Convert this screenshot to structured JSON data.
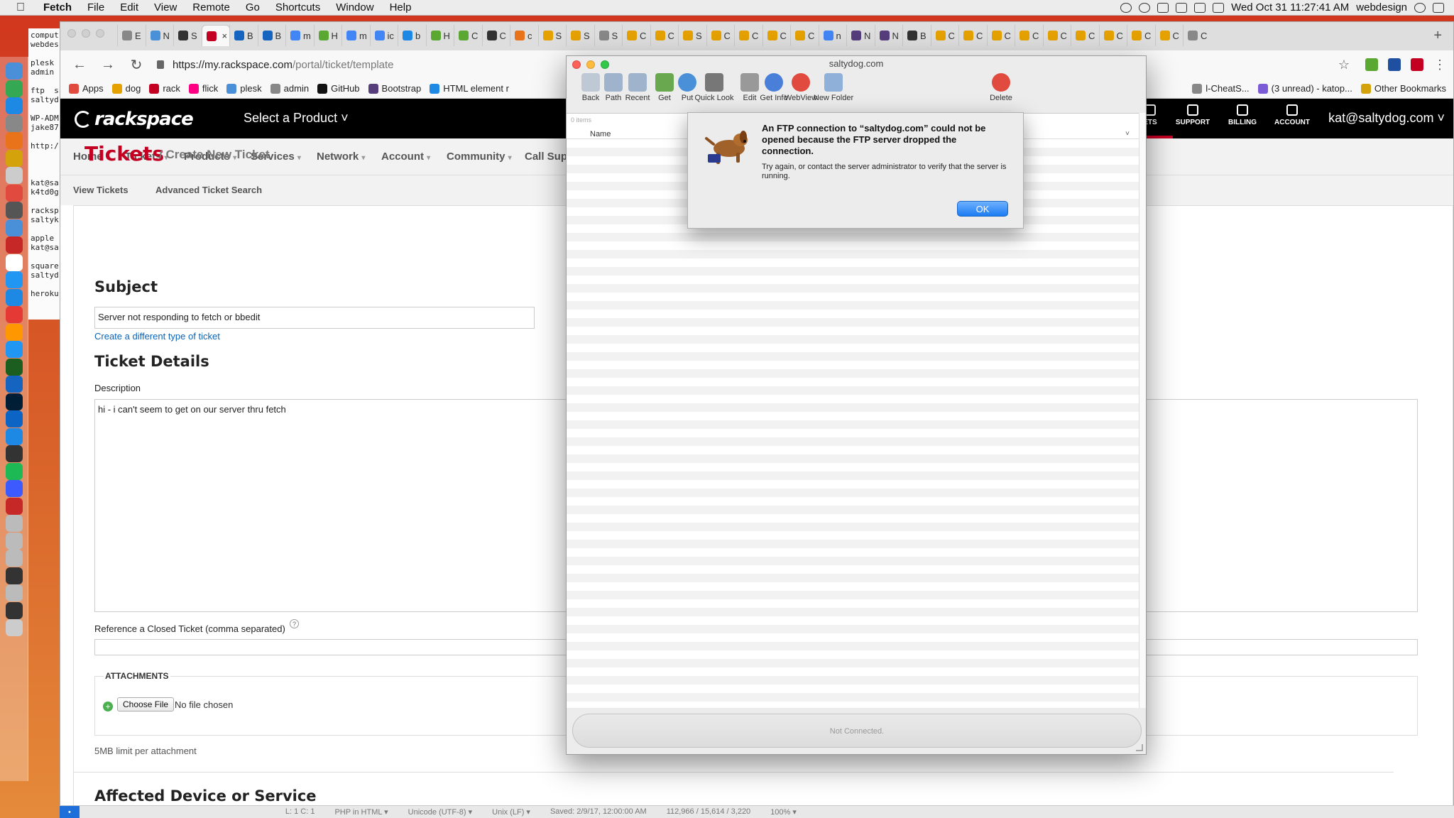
{
  "menubar": {
    "app_name": "Fetch",
    "items": [
      "File",
      "Edit",
      "View",
      "Remote",
      "Go",
      "Shortcuts",
      "Window",
      "Help"
    ],
    "clock": "Wed Oct 31  11:27:41 AM",
    "user": "webdesign"
  },
  "stickies": {
    "lines": [
      "comput",
      "webdes",
      "",
      "plesk",
      "admin",
      "",
      "ftp  s",
      "saltyd",
      "",
      "WP-ADM",
      "jake87",
      "",
      "http:/",
      "",
      "",
      "",
      "kat@sa",
      "k4td0g",
      "",
      "racksp",
      "saltyk",
      "",
      "apple",
      "kat@sa",
      "",
      "square",
      "saltyd",
      "",
      "heroku"
    ]
  },
  "browser": {
    "tabs": [
      {
        "label": "E",
        "color": "#888888"
      },
      {
        "label": "N",
        "color": "#4a90d9"
      },
      {
        "label": "S",
        "color": "#333333"
      },
      {
        "label": "",
        "color": "#c40022"
      },
      {
        "label": "B",
        "color": "#1565c0"
      },
      {
        "label": "B",
        "color": "#1565c0"
      },
      {
        "label": "m",
        "color": "#4285f4"
      },
      {
        "label": "H",
        "color": "#5aa832"
      },
      {
        "label": "m",
        "color": "#4285f4"
      },
      {
        "label": "ic",
        "color": "#4285f4"
      },
      {
        "label": "b",
        "color": "#1e88e5"
      },
      {
        "label": "H",
        "color": "#5aa832"
      },
      {
        "label": "C",
        "color": "#5aa832"
      },
      {
        "label": "C",
        "color": "#333333"
      },
      {
        "label": "c",
        "color": "#e8731a"
      },
      {
        "label": "S",
        "color": "#e5a100"
      },
      {
        "label": "S",
        "color": "#e5a100"
      },
      {
        "label": "S",
        "color": "#888888"
      },
      {
        "label": "C",
        "color": "#e5a100"
      },
      {
        "label": "C",
        "color": "#e5a100"
      },
      {
        "label": "S",
        "color": "#e5a100"
      },
      {
        "label": "C",
        "color": "#e5a100"
      },
      {
        "label": "C",
        "color": "#e5a100"
      },
      {
        "label": "C",
        "color": "#e5a100"
      },
      {
        "label": "C",
        "color": "#e5a100"
      },
      {
        "label": "n",
        "color": "#4285f4"
      },
      {
        "label": "N",
        "color": "#563d7c"
      },
      {
        "label": "N",
        "color": "#563d7c"
      },
      {
        "label": "B",
        "color": "#333333"
      },
      {
        "label": "C",
        "color": "#e5a100"
      },
      {
        "label": "C",
        "color": "#e5a100"
      },
      {
        "label": "C",
        "color": "#e5a100"
      },
      {
        "label": "C",
        "color": "#e5a100"
      },
      {
        "label": "C",
        "color": "#e5a100"
      },
      {
        "label": "C",
        "color": "#e5a100"
      },
      {
        "label": "C",
        "color": "#e5a100"
      },
      {
        "label": "C",
        "color": "#e5a100"
      },
      {
        "label": "C",
        "color": "#e5a100"
      },
      {
        "label": "C",
        "color": "#888888"
      }
    ],
    "url_host": "https://my.rackspace.com",
    "url_path": "/portal/ticket/template",
    "bookmarks": [
      {
        "label": "Apps",
        "color": "#e04a3f"
      },
      {
        "label": "dog",
        "color": "#e5a100"
      },
      {
        "label": "rack",
        "color": "#c40022"
      },
      {
        "label": "flick",
        "color": "#ff0084"
      },
      {
        "label": "plesk",
        "color": "#4a90d9"
      },
      {
        "label": "admin",
        "color": "#888888"
      },
      {
        "label": "GitHub",
        "color": "#111111"
      },
      {
        "label": "Bootstrap",
        "color": "#563d7c"
      },
      {
        "label": "HTML element r",
        "color": "#1e88e5"
      }
    ],
    "bookmarks_right": [
      {
        "label": "l-CheatS...",
        "color": "#888888"
      },
      {
        "label": "(3 unread) - katop...",
        "color": "#7b5cd6"
      }
    ],
    "other_bookmarks": "Other Bookmarks"
  },
  "rackspace": {
    "logo_text": "rackspace",
    "select_product": "Select a Product",
    "nav_buttons": [
      "ETS",
      "SUPPORT",
      "BILLING",
      "ACCOUNT"
    ],
    "user": "kat@saltydog.com",
    "main_nav": [
      "Home",
      "Tickets",
      "Products",
      "Services",
      "Network",
      "Account",
      "Community",
      "Call Sup"
    ],
    "sub_nav": [
      "View Tickets",
      "Advanced Ticket Search"
    ],
    "page_title": "Tickets",
    "breadcrumb": "/ Create New Ticket",
    "subject_heading": "Subject",
    "subject_value": "Server not responding to fetch or bbedit",
    "different_ticket_link": "Create a different type of ticket",
    "details_heading": "Ticket Details",
    "description_label": "Description",
    "description_value": "hi - i can't seem to get on our server thru fetch",
    "reference_label": "Reference a Closed Ticket (comma separated)",
    "attachments_label": "ATTACHMENTS",
    "choose_file": "Choose File",
    "no_file": "No file chosen",
    "size_limit": "5MB limit per attachment",
    "affected_heading": "Affected Device or Service"
  },
  "fetch": {
    "window_title": "saltydog.com",
    "toolbar": [
      "Back",
      "Path",
      "Recent",
      "Get",
      "Put",
      "Quick Look",
      "Edit",
      "Get Info",
      "WebView",
      "New Folder",
      "Delete"
    ],
    "item_count": "0 items",
    "column_name": "Name",
    "status": "Not Connected."
  },
  "alert": {
    "title": "An FTP connection to “saltydog.com” could not be opened because the FTP server dropped the connection.",
    "message": "Try again, or contact the server administrator to verify that the server is running.",
    "ok_label": "OK"
  },
  "bbedit_status": [
    "L: 1 C: 1",
    "PHP in HTML ▾",
    "Unicode (UTF-8) ▾",
    "Unix (LF) ▾",
    "Saved: 2/9/17, 12:00:00 AM",
    "112,966 / 15,614 / 3,220",
    "100% ▾"
  ]
}
